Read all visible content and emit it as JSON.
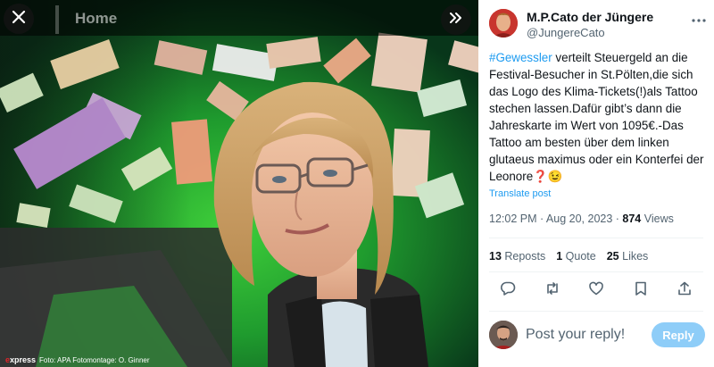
{
  "media": {
    "page_label": "Home",
    "caption_brand_e": "e",
    "caption_brand_rest": "xpress",
    "caption_credit": "Foto: APA Fotomontage: O. Ginner"
  },
  "tweet": {
    "author_name": "M.P.Cato der Jüngere",
    "author_handle": "@JungereCato",
    "hashtag": "#Gewessler",
    "text": " verteilt Steuergeld an die Festival-Besucher in St.Pölten,die sich das Logo des Klima-Tickets(!)als Tattoo stechen lassen.Dafür gibt’s dann die Jahreskarte im Wert von 1095€.-Das Tattoo am besten über dem linken glutaeus maximus oder ein Konterfei der Leonore❓😉",
    "translate_label": "Translate post",
    "timestamp": "12:02 PM · Aug 20, 2023 · ",
    "views_count": "874",
    "views_label": " Views",
    "reposts_count": "13",
    "reposts_label": " Reposts",
    "quotes_count": "1",
    "quotes_label": " Quote",
    "likes_count": "25",
    "likes_label": " Likes"
  },
  "reply": {
    "placeholder": "Post your reply!",
    "button_label": "Reply"
  },
  "icons": {
    "close": "close-icon",
    "expand": "expand-icon",
    "more": "more-icon",
    "reply": "reply-icon",
    "repost": "repost-icon",
    "like": "like-icon",
    "bookmark": "bookmark-icon",
    "share": "share-icon"
  },
  "colors": {
    "accent": "#1d9bf0",
    "reply_button": "#8ecdf8",
    "media_green": "#1f8a36",
    "brand_red": "#e1252a"
  }
}
